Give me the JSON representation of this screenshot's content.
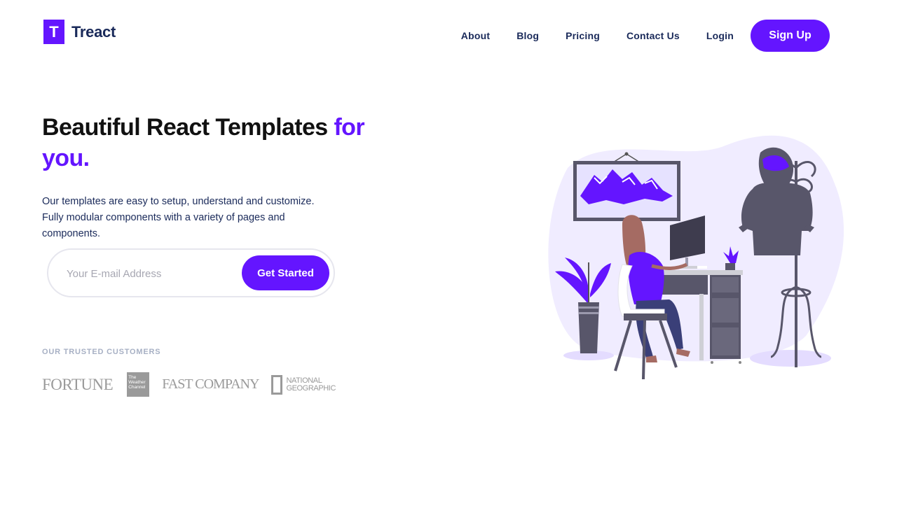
{
  "brand": {
    "mark": "T",
    "name": "Treact"
  },
  "nav": {
    "items": [
      "About",
      "Blog",
      "Pricing",
      "Contact Us",
      "Login"
    ],
    "signup_label": "Sign Up"
  },
  "hero": {
    "title_main": "Beautiful React Templates ",
    "title_accent": "for you.",
    "description": "Our templates are easy to setup, understand and customize. Fully modular components with a variety of pages and components.",
    "email_placeholder": "Your E-mail Address",
    "cta_label": "Get Started"
  },
  "customers": {
    "label": "OUR TRUSTED CUSTOMERS",
    "logos": [
      "FORTUNE",
      "The Weather Channel",
      "FAST COMPANY",
      "NATIONAL GEOGRAPHIC"
    ]
  },
  "colors": {
    "accent": "#6415ff",
    "navy": "#1a2a5a",
    "blob": "#f0ecff"
  },
  "icons": {
    "illustration": "woman-at-desk-illustration"
  }
}
